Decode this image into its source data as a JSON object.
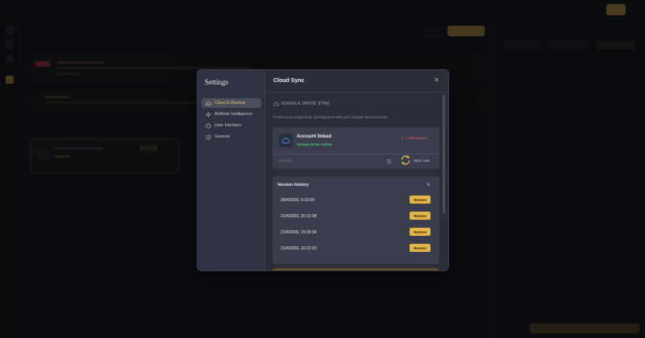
{
  "settings": {
    "title": "Settings",
    "nav": [
      {
        "label": "Cloud & Backup",
        "icon": "cloud-icon",
        "active": true
      },
      {
        "label": "Artificial Intelligence",
        "icon": "sparkle-icon",
        "active": false
      },
      {
        "label": "User Interface",
        "icon": "palette-icon",
        "active": false
      },
      {
        "label": "General",
        "icon": "info-icon",
        "active": false
      }
    ]
  },
  "cloud_sync": {
    "title": "Cloud Sync",
    "section_title": "GOOGLE DRIVE SYNC",
    "description": "Protect your projects by syncing them with your Google Drive account.",
    "account": {
      "name": "Account linked",
      "status": "Google Drive Active",
      "disconnect_label": "Disconnect",
      "sync_text": "Syncing...",
      "sync_now_label": "Sync now"
    },
    "history": {
      "title": "Version history",
      "restore_label": "Restore",
      "items": [
        "28/4/2026, 0:10:29",
        "21/4/2026, 20:12:08",
        "21/4/2026, 19:24:34",
        "21/4/2026, 19:22:33"
      ]
    }
  },
  "colors": {
    "accent": "#e3b64c",
    "success": "#4fc17a",
    "danger": "#e0666b"
  }
}
